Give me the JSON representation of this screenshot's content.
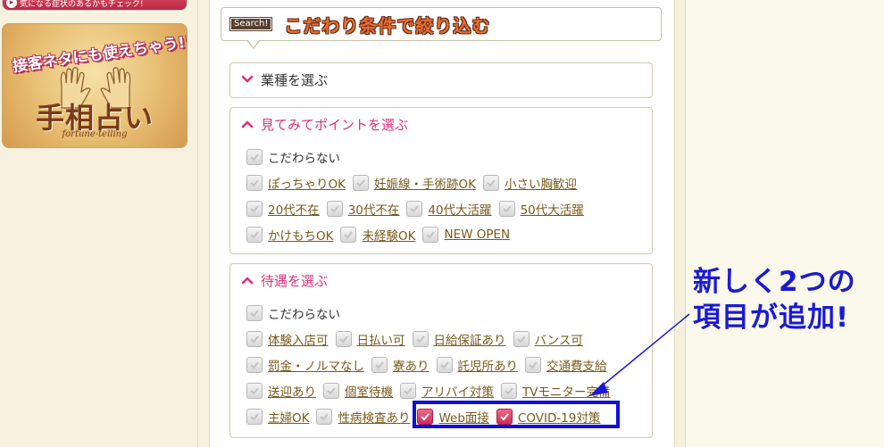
{
  "sidebar": {
    "top_banner_text": "気になる症状のあるかもチェック!",
    "palm_banner": {
      "catch": "接客ネタにも使えちゃう!!",
      "title": "手相占い",
      "subtitle": "fortune-telling"
    }
  },
  "search": {
    "tag": "Search!",
    "heading": "こだわり条件で絞り込む"
  },
  "panels": [
    {
      "title": "業種を選ぶ",
      "state": "closed",
      "rows": []
    },
    {
      "title": "見てみてポイントを選ぶ",
      "state": "open",
      "rows": [
        [
          "こだわらない"
        ],
        [
          "ぽっちゃりOK",
          "妊娠線・手術跡OK",
          "小さい胸歓迎"
        ],
        [
          "20代不在",
          "30代不在",
          "40代大活躍",
          "50代大活躍"
        ],
        [
          "かけもちOK",
          "未経験OK",
          "NEW OPEN"
        ]
      ]
    },
    {
      "title": "待遇を選ぶ",
      "state": "open",
      "rows": [
        [
          "こだわらない"
        ],
        [
          "体験入店可",
          "日払い可",
          "日給保証あり",
          "バンス可"
        ],
        [
          "罰金・ノルマなし",
          "寮あり",
          "託児所あり",
          "交通費支給"
        ],
        [
          "送迎あり",
          "個室待機",
          "アリバイ対策",
          "TVモニター完備"
        ],
        [
          "主婦OK",
          "性病検査あり",
          "Web面接",
          "COVID-19対策"
        ]
      ]
    }
  ],
  "annotation": {
    "line1": "新しく2つの",
    "line2": "項目が追加!"
  },
  "colors": {
    "accent_pink": "#e0307a",
    "link_brown": "#7a5a1a",
    "annotation_blue": "#1a1ad6",
    "heading_orange": "#f06a2a"
  }
}
